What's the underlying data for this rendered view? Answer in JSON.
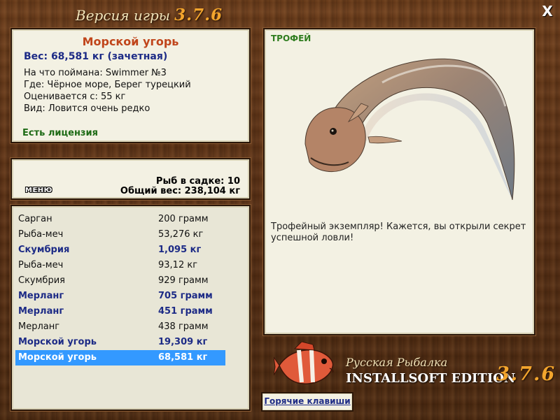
{
  "window": {
    "title": "Версия игры",
    "version": "3.7.6",
    "close_label": "X"
  },
  "fish_info": {
    "name": "Морской угорь",
    "weight_line": "Вес: 68,581 кг (зачетная)",
    "lines": [
      "На что поймана: Swimmer №3",
      "Где: Чёрное море, Берег турецкий",
      "Оценивается с: 55 кг",
      "Вид: Ловится очень редко"
    ],
    "license": "Есть лицензия"
  },
  "cage": {
    "menu_label": "МЕНЮ",
    "count_line": "Рыб в садке: 10",
    "weight_line": "Общий вес: 238,104 кг"
  },
  "catch_list": [
    {
      "name": "Сарган",
      "weight": "200 грамм",
      "bold": false,
      "selected": false
    },
    {
      "name": "Рыба-меч",
      "weight": "53,276 кг",
      "bold": false,
      "selected": false
    },
    {
      "name": "Скумбрия",
      "weight": "1,095 кг",
      "bold": true,
      "selected": false
    },
    {
      "name": "Рыба-меч",
      "weight": "93,12 кг",
      "bold": false,
      "selected": false
    },
    {
      "name": "Скумбрия",
      "weight": "929 грамм",
      "bold": false,
      "selected": false
    },
    {
      "name": "Мерланг",
      "weight": "705 грамм",
      "bold": true,
      "selected": false
    },
    {
      "name": "Мерланг",
      "weight": "451 грамм",
      "bold": true,
      "selected": false
    },
    {
      "name": "Мерланг",
      "weight": "438 грамм",
      "bold": false,
      "selected": false
    },
    {
      "name": "Морской угорь",
      "weight": "19,309 кг",
      "bold": true,
      "selected": false
    },
    {
      "name": "Морской угорь",
      "weight": "68,581 кг",
      "bold": true,
      "selected": true
    }
  ],
  "trophy": {
    "label": "ТРОФЕЙ",
    "text": "Трофейный экземпляр! Кажется, вы открыли секрет успешной ловли!"
  },
  "brand": {
    "line1": "Русская Рыбалка",
    "line2": "INSTALLSOFT EDITION",
    "version": "3.7.6"
  },
  "hotkeys_label": "Горячие клавиши",
  "colors": {
    "selection": "#3399ff",
    "highlight_text": "#1d2b86",
    "name_accent": "#c0451b",
    "license_green": "#1e6b16",
    "version_orange": "#f3a52d"
  }
}
